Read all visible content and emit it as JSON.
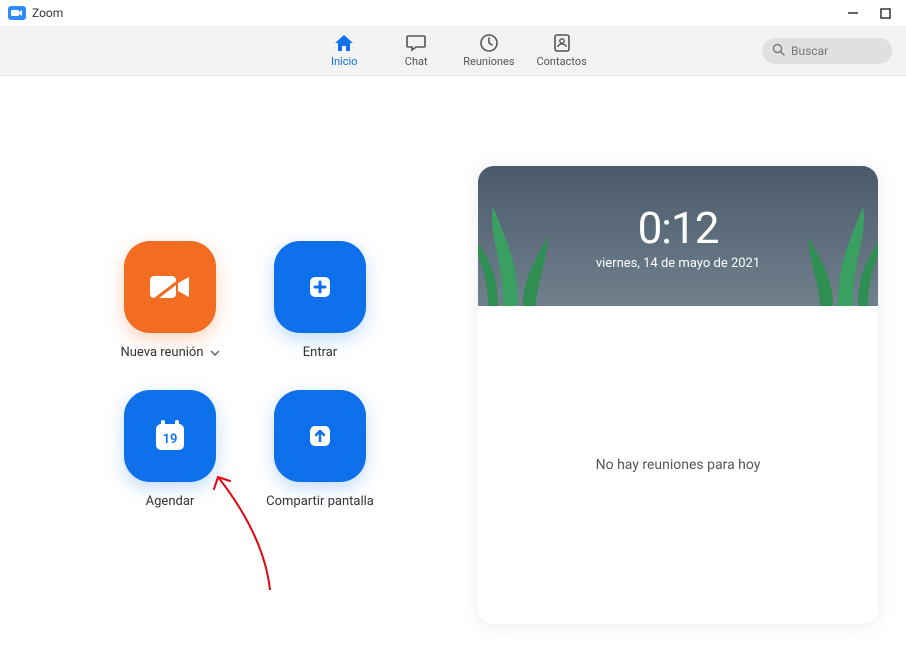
{
  "window": {
    "title": "Zoom"
  },
  "nav": {
    "tabs": [
      {
        "id": "inicio",
        "label": "Inicio",
        "active": true
      },
      {
        "id": "chat",
        "label": "Chat",
        "active": false
      },
      {
        "id": "reuniones",
        "label": "Reuniones",
        "active": false
      },
      {
        "id": "contactos",
        "label": "Contactos",
        "active": false
      }
    ]
  },
  "search": {
    "placeholder": "Buscar"
  },
  "tiles": {
    "new_meeting": "Nueva reunión",
    "join": "Entrar",
    "schedule": "Agendar",
    "schedule_day": "19",
    "share_screen": "Compartir pantalla"
  },
  "calendar": {
    "time": "0:12",
    "date": "viernes, 14 de mayo de 2021",
    "empty_message": "No hay reuniones para hoy"
  }
}
